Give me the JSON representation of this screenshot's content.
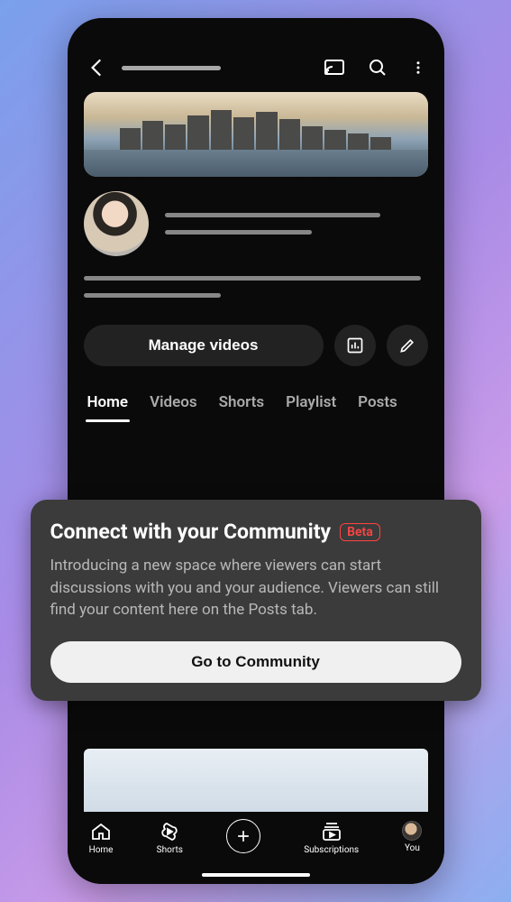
{
  "actions": {
    "manage_label": "Manage videos"
  },
  "tabs": [
    "Home",
    "Videos",
    "Shorts",
    "Playlist",
    "Posts"
  ],
  "active_tab_index": 0,
  "promo": {
    "title": "Connect with your Community",
    "badge": "Beta",
    "description": "Introducing a new space where viewers can start discussions with you and your audience. Viewers can still find your content here on the Posts tab.",
    "cta": "Go to Community"
  },
  "bottom_nav": {
    "home": "Home",
    "shorts": "Shorts",
    "subscriptions": "Subscriptions",
    "you": "You"
  }
}
